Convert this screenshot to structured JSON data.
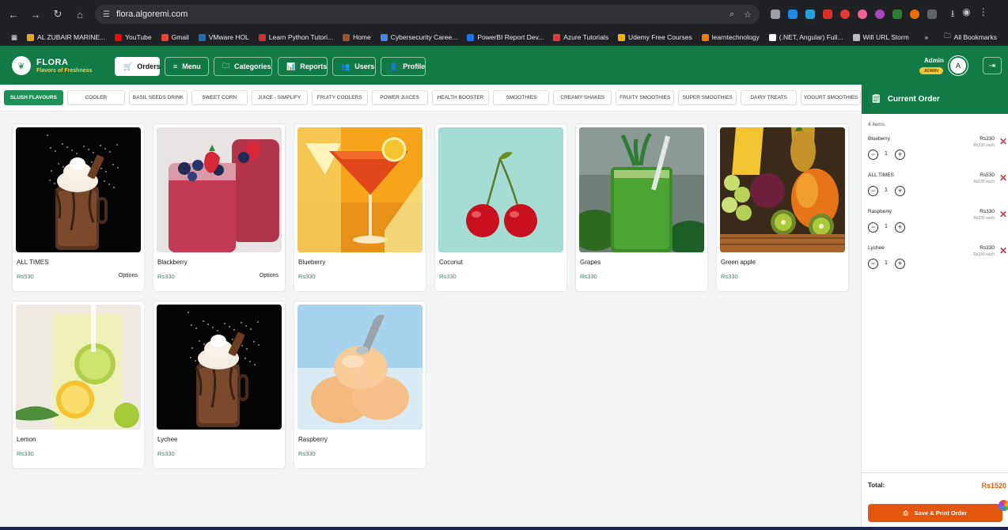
{
  "browser": {
    "url": "flora.algoremi.com",
    "bookmarks": [
      {
        "label": "AL ZUBAIR MARINE...",
        "color": "#e3a72f"
      },
      {
        "label": "YouTube",
        "color": "#ff0000"
      },
      {
        "label": "Gmail",
        "color": "#ea4335"
      },
      {
        "label": "VMware HOL",
        "color": "#1f6fb2"
      },
      {
        "label": "Learn Python Tutori...",
        "color": "#d32f2f"
      },
      {
        "label": "Home",
        "color": "#a0522d"
      },
      {
        "label": "Cybersecurity Caree...",
        "color": "#4285f4"
      },
      {
        "label": "PowerBI Report Dev...",
        "color": "#1a73e8"
      },
      {
        "label": "Azure Tutorials",
        "color": "#e53935"
      },
      {
        "label": "Udemy Free Courses",
        "color": "#f5b400"
      },
      {
        "label": "learntechnology",
        "color": "#f57c00"
      },
      {
        "label": "(.NET, Angular) Full...",
        "color": "#ffffff"
      },
      {
        "label": "Wifi URL Storm",
        "color": "#bdbdbd"
      }
    ],
    "all_bookmarks": "All Bookmarks",
    "more_bookmarks": "»"
  },
  "header": {
    "brand": "FLORA",
    "tagline": "Flavors of Freshness",
    "nav": [
      {
        "label": "Orders",
        "icon": "cart-icon",
        "glyph": "🛒",
        "active": true
      },
      {
        "label": "Menu",
        "icon": "menu-icon",
        "glyph": "≡",
        "active": false
      },
      {
        "label": "Categories",
        "icon": "folder-icon",
        "glyph": "🗀",
        "active": false
      },
      {
        "label": "Reports",
        "icon": "chart-icon",
        "glyph": "📊",
        "active": false
      },
      {
        "label": "Users",
        "icon": "users-icon",
        "glyph": "👥",
        "active": false
      },
      {
        "label": "Profile",
        "icon": "user-icon",
        "glyph": "👤",
        "active": false
      }
    ],
    "admin_name": "Admin",
    "admin_badge": "ADMIN",
    "avatar_letter": "A",
    "logout_glyph": "⇥"
  },
  "categories": [
    {
      "label": "SLUSH FLAVOURS",
      "active": true
    },
    {
      "label": "COOLER",
      "active": false
    },
    {
      "label": "BASIL SEEDS DRINK",
      "active": false
    },
    {
      "label": "SWEET CORN",
      "active": false
    },
    {
      "label": "JUICE - SIMPLIFY",
      "active": false
    },
    {
      "label": "FRUITY COOLERS",
      "active": false
    },
    {
      "label": "POWER JUICES",
      "active": false
    },
    {
      "label": "HEALTH BOOSTER",
      "active": false
    },
    {
      "label": "SMOOTHIES",
      "active": false
    },
    {
      "label": "CREAMY SHAKES",
      "active": false
    },
    {
      "label": "FRUITY SMOOTHIES",
      "active": false
    },
    {
      "label": "SUPER SMOOTHIES",
      "active": false
    },
    {
      "label": "DAIRY TREATS",
      "active": false
    },
    {
      "label": "YOGURT SMOOTHIES",
      "active": false
    }
  ],
  "products": [
    {
      "name": "ALL TIMES",
      "price": "Rs530",
      "options": "Options",
      "image": "chocolate-shake"
    },
    {
      "name": "Blackberry",
      "price": "Rs330",
      "options": "Options",
      "image": "berry-smoothie"
    },
    {
      "name": "Blueberry",
      "price": "Rs330",
      "options": "",
      "image": "cocktail"
    },
    {
      "name": "Coconut",
      "price": "Rs330",
      "options": "",
      "image": "cherries"
    },
    {
      "name": "Grapes",
      "price": "Rs330",
      "options": "",
      "image": "green-juice"
    },
    {
      "name": "Green apple",
      "price": "Rs330",
      "options": "",
      "image": "fruit-basket"
    },
    {
      "name": "Lemon",
      "price": "Rs330",
      "options": "",
      "image": "lemonade"
    },
    {
      "name": "Lychee",
      "price": "Rs330",
      "options": "",
      "image": "chocolate-shake"
    },
    {
      "name": "Raspberry",
      "price": "Rs330",
      "options": "",
      "image": "ice-cream"
    }
  ],
  "order": {
    "title": "Current Order",
    "count_text": "4 items",
    "items": [
      {
        "name": "Blueberry",
        "total": "Rs330",
        "each": "Rs330 each",
        "qty": "1"
      },
      {
        "name": "ALL TIMES",
        "total": "Rs530",
        "each": "Rs530 each",
        "qty": "1"
      },
      {
        "name": "Raspberry",
        "total": "Rs330",
        "each": "Rs330 each",
        "qty": "1"
      },
      {
        "name": "Lychee",
        "total": "Rs330",
        "each": "Rs330 each",
        "qty": "1"
      }
    ],
    "total_label": "Total:",
    "total_value": "Rs1520",
    "print_label": "Save & Print Order"
  }
}
